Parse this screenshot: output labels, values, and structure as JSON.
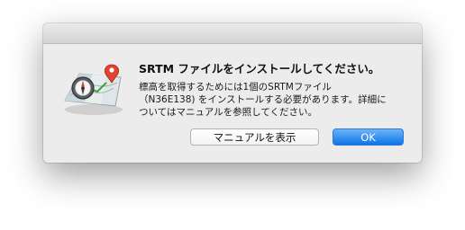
{
  "dialog": {
    "title": "SRTM ファイルをインストールしてください。",
    "message": "標高を取得するためには1個のSRTMファイル\n（N36E138) をインストールする必要があります。詳細に\nついてはマニュアルを参照してください。",
    "app_icon": "map-compass-icon"
  },
  "buttons": {
    "manual_label": "マニュアルを表示",
    "ok_label": "OK"
  },
  "colors": {
    "primary_button": "#1a7ef0",
    "dialog_background": "#ececec"
  }
}
